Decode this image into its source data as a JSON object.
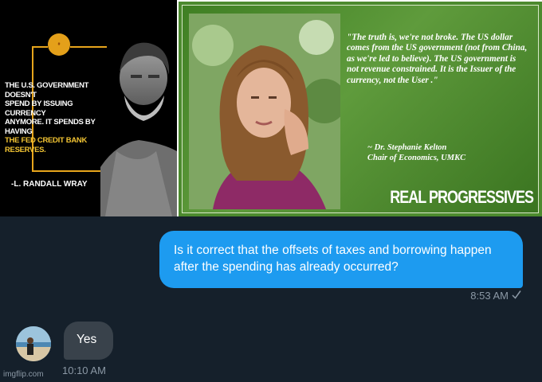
{
  "images": {
    "left": {
      "badge_text": "#",
      "quote_lines": [
        "THE U.S. GOVERNMENT DOESN'T",
        "SPEND BY ISSUING CURRENCY",
        "ANYMORE. IT SPENDS BY HAVING"
      ],
      "quote_highlight": "THE FED CREDIT BANK RESERVES.",
      "author": "-L. RANDALL WRAY"
    },
    "right": {
      "quote": "\"The truth is, we're not broke. The US dollar comes from the US government (not from China, as we're led to believe). The US government is not revenue constrained.  It is the Issuer of the currency, not the User .\"",
      "attribution_line1": "~ Dr. Stephanie Kelton",
      "attribution_line2": "Chair of Economics, UMKC",
      "brand": "REAL PROGRESSIVES"
    }
  },
  "messages": [
    {
      "direction": "outgoing",
      "text": "Is it correct that the offsets of taxes and borrowing happen after the spending has already occurred?",
      "time": "8:53 AM",
      "status_icon": "check-icon"
    },
    {
      "direction": "incoming",
      "text": "Yes",
      "time": "10:10 AM"
    }
  ],
  "watermark": "imgflip.com",
  "colors": {
    "background": "#15202b",
    "outgoing_bubble": "#1d9bf0",
    "incoming_bubble": "#39424b",
    "timestamp": "#8b98a5"
  }
}
